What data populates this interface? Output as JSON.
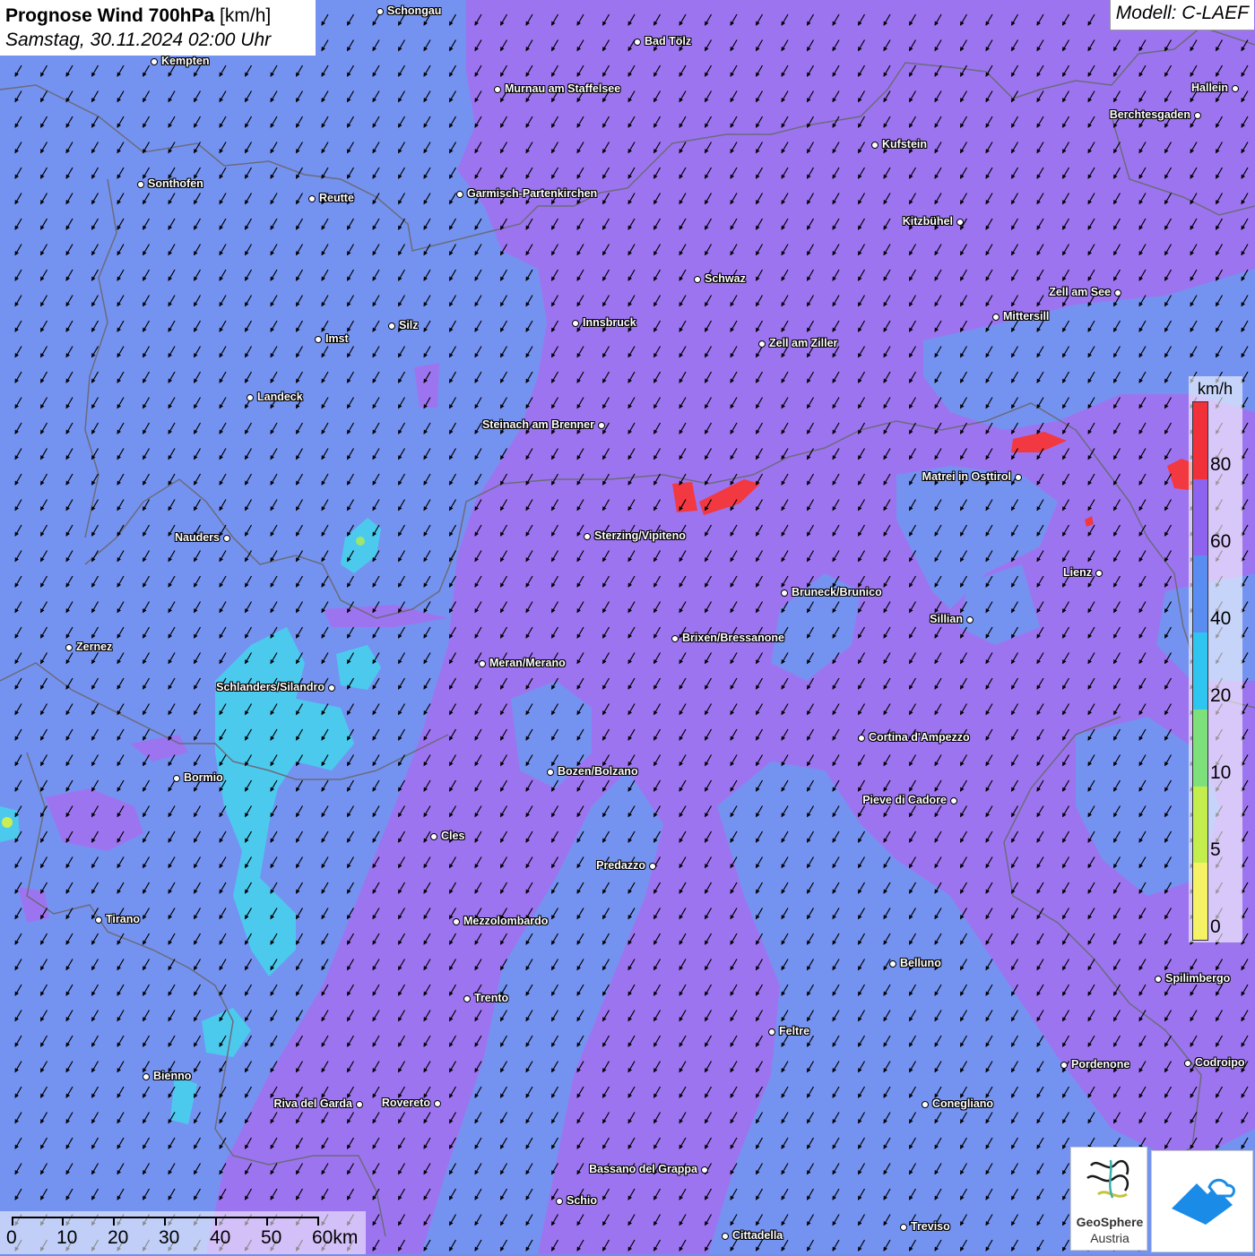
{
  "title": {
    "main": "Prognose Wind 700hPa",
    "unit": "[km/h]",
    "datetime": "Samstag, 30.11.2024 02:00 Uhr"
  },
  "model": "Modell: C-LAEF",
  "legend": {
    "unit": "km/h",
    "ticks": [
      "80",
      "60",
      "40",
      "20",
      "10",
      "5",
      "0"
    ],
    "colors": [
      "#f2303a",
      "#8e63f0",
      "#5a8df2",
      "#2ec5f0",
      "#7ee07a",
      "#c4ee4e",
      "#f6f266"
    ]
  },
  "scale_bar": {
    "labels": [
      "0",
      "10",
      "20",
      "30",
      "40",
      "50",
      "60km"
    ]
  },
  "wind_direction": "north-northeast, arrows pointing south-southwest",
  "cities": [
    {
      "name": "Schongau",
      "side": "r"
    },
    {
      "name": "Kempten",
      "side": "r"
    },
    {
      "name": "Bad Tölz",
      "side": "r"
    },
    {
      "name": "Murnau am Staffelsee",
      "side": "r"
    },
    {
      "name": "Hallein",
      "side": "l"
    },
    {
      "name": "Berchtesgaden",
      "side": "l"
    },
    {
      "name": "Kufstein",
      "side": "r"
    },
    {
      "name": "Sonthofen",
      "side": "r"
    },
    {
      "name": "Reutte",
      "side": "r"
    },
    {
      "name": "Garmisch-Partenkirchen",
      "side": "r"
    },
    {
      "name": "Kitzbühel",
      "side": "l"
    },
    {
      "name": "Schwaz",
      "side": "r"
    },
    {
      "name": "Zell am See",
      "side": "l"
    },
    {
      "name": "Mittersill",
      "side": "r"
    },
    {
      "name": "Innsbruck",
      "side": "r"
    },
    {
      "name": "Silz",
      "side": "r"
    },
    {
      "name": "Imst",
      "side": "r"
    },
    {
      "name": "Zell am Ziller",
      "side": "r"
    },
    {
      "name": "Landeck",
      "side": "r"
    },
    {
      "name": "Steinach am Brenner",
      "side": "l"
    },
    {
      "name": "Matrei in Osttirol",
      "side": "l"
    },
    {
      "name": "Nauders",
      "side": "l"
    },
    {
      "name": "Sterzing/Vipiteno",
      "side": "r"
    },
    {
      "name": "Lienz",
      "side": "l"
    },
    {
      "name": "Bruneck/Brunico",
      "side": "r"
    },
    {
      "name": "Sillian",
      "side": "l"
    },
    {
      "name": "Zernez",
      "side": "r"
    },
    {
      "name": "Brixen/Bressanone",
      "side": "r"
    },
    {
      "name": "Meran/Merano",
      "side": "r"
    },
    {
      "name": "Schlanders/Silandro",
      "side": "l"
    },
    {
      "name": "Cortina d'Ampezzo",
      "side": "r"
    },
    {
      "name": "Bozen/Bolzano",
      "side": "r"
    },
    {
      "name": "Bormio",
      "side": "r"
    },
    {
      "name": "Pieve di Cadore",
      "side": "l"
    },
    {
      "name": "Cles",
      "side": "r"
    },
    {
      "name": "Predazzo",
      "side": "l"
    },
    {
      "name": "Tirano",
      "side": "r"
    },
    {
      "name": "Mezzolombardo",
      "side": "r"
    },
    {
      "name": "Belluno",
      "side": "r"
    },
    {
      "name": "Spilimbergo",
      "side": "r"
    },
    {
      "name": "Trento",
      "side": "r"
    },
    {
      "name": "Feltre",
      "side": "r"
    },
    {
      "name": "Pordenone",
      "side": "r"
    },
    {
      "name": "Codroipo",
      "side": "r"
    },
    {
      "name": "Bienno",
      "side": "r"
    },
    {
      "name": "Riva del Garda",
      "side": "l"
    },
    {
      "name": "Rovereto",
      "side": "l"
    },
    {
      "name": "Conegliano",
      "side": "r"
    },
    {
      "name": "Bassano del Grappa",
      "side": "l"
    },
    {
      "name": "Schio",
      "side": "r"
    },
    {
      "name": "Treviso",
      "side": "r"
    },
    {
      "name": "Cittadella",
      "side": "r"
    }
  ],
  "logos": {
    "geosphere_line1": "GeoSphere",
    "geosphere_line2": "Austria"
  }
}
